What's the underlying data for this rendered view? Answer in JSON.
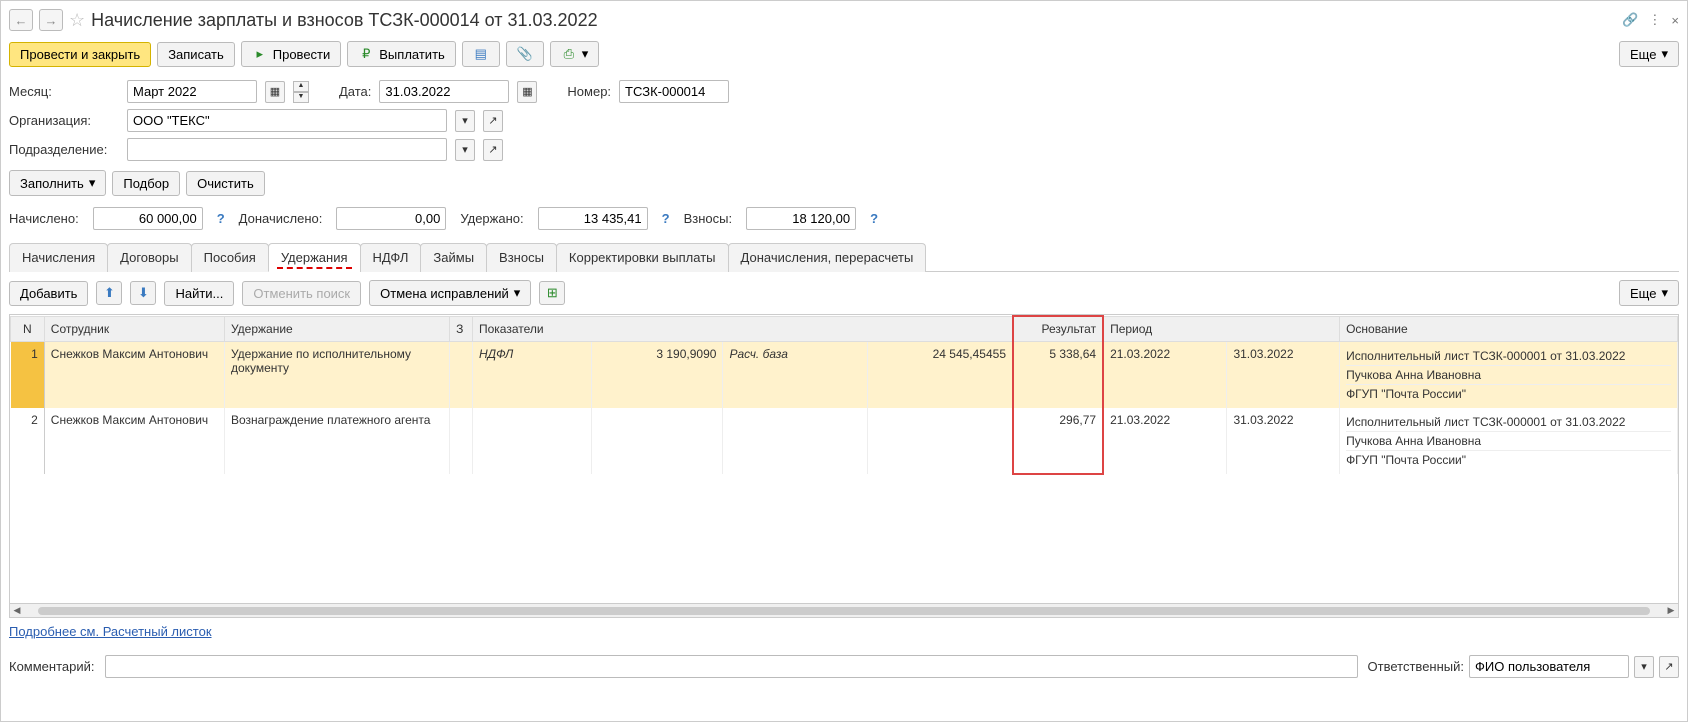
{
  "title": "Начисление зарплаты и взносов ТСЗК-000014 от 31.03.2022",
  "toolbar": {
    "post_close": "Провести и закрыть",
    "save": "Записать",
    "post": "Провести",
    "pay": "Выплатить",
    "more": "Еще"
  },
  "fields": {
    "month_label": "Месяц:",
    "month_value": "Март 2022",
    "date_label": "Дата:",
    "date_value": "31.03.2022",
    "number_label": "Номер:",
    "number_value": "ТСЗК-000014",
    "org_label": "Организация:",
    "org_value": "ООО \"ТЕКС\"",
    "dept_label": "Подразделение:",
    "dept_value": ""
  },
  "fill_bar": {
    "fill": "Заполнить",
    "pick": "Подбор",
    "clear": "Очистить"
  },
  "totals": {
    "accrued_label": "Начислено:",
    "accrued": "60 000,00",
    "add_accrued_label": "Доначислено:",
    "add_accrued": "0,00",
    "withheld_label": "Удержано:",
    "withheld": "13 435,41",
    "contrib_label": "Взносы:",
    "contrib": "18 120,00"
  },
  "tabs": [
    "Начисления",
    "Договоры",
    "Пособия",
    "Удержания",
    "НДФЛ",
    "Займы",
    "Взносы",
    "Корректировки выплаты",
    "Доначисления, перерасчеты"
  ],
  "subtoolbar": {
    "add": "Добавить",
    "find": "Найти...",
    "cancel_find": "Отменить поиск",
    "cancel_fix": "Отмена исправлений",
    "more": "Еще"
  },
  "columns": {
    "n": "N",
    "emp": "Сотрудник",
    "ded": "Удержание",
    "ind_h": "З",
    "ind": "Показатели",
    "res": "Результат",
    "per": "Период",
    "bas": "Основание"
  },
  "rows": [
    {
      "n": "1",
      "emp": "Снежков Максим Антонович",
      "ded": "Удержание по исполнительному документу",
      "ind1_name": "НДФЛ",
      "ind1_val": "3 190,9090",
      "ind2_name": "Расч. база",
      "ind2_val": "24 545,45455",
      "res": "5 338,64",
      "per_from": "21.03.2022",
      "per_to": "31.03.2022",
      "basis1": "Исполнительный лист ТСЗК-000001 от 31.03.2022",
      "basis2": "Пучкова Анна Ивановна",
      "basis3": "ФГУП \"Почта России\""
    },
    {
      "n": "2",
      "emp": "Снежков Максим Антонович",
      "ded": "Вознаграждение платежного агента",
      "ind1_name": "",
      "ind1_val": "",
      "ind2_name": "",
      "ind2_val": "",
      "res": "296,77",
      "per_from": "21.03.2022",
      "per_to": "31.03.2022",
      "basis1": "Исполнительный лист ТСЗК-000001 от 31.03.2022",
      "basis2": "Пучкова Анна Ивановна",
      "basis3": "ФГУП \"Почта России\""
    }
  ],
  "link": "Подробнее см. Расчетный листок",
  "comment_label": "Комментарий:",
  "comment_value": "",
  "resp_label": "Ответственный:",
  "resp_value": "ФИО пользователя"
}
